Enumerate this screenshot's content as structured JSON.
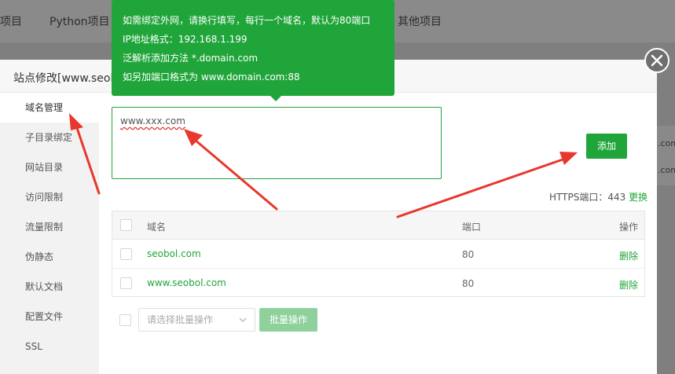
{
  "background": {
    "tabs": [
      "项目",
      "Python项目",
      "其他项目"
    ],
    "right_fragments": [
      ".com",
      ".com"
    ]
  },
  "dialog": {
    "title": "站点修改[www.seobol",
    "sidebar": [
      "域名管理",
      "子目录绑定",
      "网站目录",
      "访问限制",
      "流量限制",
      "伪静态",
      "默认文档",
      "配置文件",
      "SSL"
    ],
    "active_index": 0,
    "domain_input_value": "www.xxx.com",
    "add_button": "添加",
    "https_label": "HTTPS端口：443",
    "https_change": "更换",
    "table": {
      "headers": {
        "domain": "域名",
        "port": "端口",
        "action": "操作"
      },
      "rows": [
        {
          "domain": "seobol.com",
          "port": "80",
          "action": "删除"
        },
        {
          "domain": "www.seobol.com",
          "port": "80",
          "action": "删除"
        }
      ]
    },
    "bulk_select_placeholder": "请选择批量操作",
    "bulk_button": "批量操作"
  },
  "tooltip": {
    "lines": [
      "如需绑定外网，请换行填写，每行一个域名，默认为80端口",
      "IP地址格式：192.168.1.199",
      "泛解析添加方法 *.domain.com",
      "如另加端口格式为 www.domain.com:88"
    ]
  },
  "colors": {
    "accent": "#20a53a",
    "arrow": "#e8372c"
  }
}
